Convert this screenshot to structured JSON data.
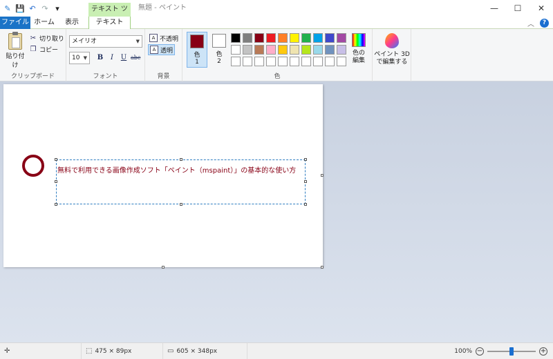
{
  "titlebar": {
    "contextual_tab_group": "テキスト ツール",
    "window_title": "無題 - ペイント",
    "minimize_glyph": "—",
    "maximize_glyph": "☐",
    "close_glyph": "✕",
    "save_glyph": "💾",
    "undo_glyph": "↶",
    "redo_glyph": "↷",
    "customize_glyph": "▾"
  },
  "tabs": {
    "file": "ファイル",
    "home": "ホーム",
    "view": "表示",
    "text": "テキスト"
  },
  "ribbon": {
    "clipboard": {
      "label": "クリップボード",
      "paste": "貼り付け",
      "cut": "切り取り",
      "copy": "コピー"
    },
    "font": {
      "label": "フォント",
      "family": "メイリオ",
      "size": "10",
      "bold": "B",
      "italic": "I",
      "underline": "U",
      "strike": "abc"
    },
    "background": {
      "label": "背景",
      "opaque": "不透明",
      "transparent": "透明",
      "icon_text": "A"
    },
    "colors": {
      "label": "色",
      "color1_label": "色",
      "color1_num": "1",
      "color2_label": "色",
      "color2_num": "2",
      "color1_value": "#880015",
      "color2_value": "#ffffff",
      "edit_line1": "色の",
      "edit_line2": "編集",
      "palette_row1": [
        "#000000",
        "#7f7f7f",
        "#880015",
        "#ed1c24",
        "#ff7f27",
        "#fff200",
        "#22b14c",
        "#00a2e8",
        "#3f48cc",
        "#a349a4"
      ],
      "palette_row2": [
        "#ffffff",
        "#c3c3c3",
        "#b97a57",
        "#ffaec9",
        "#ffc90e",
        "#efe4b0",
        "#b5e61d",
        "#99d9ea",
        "#7092be",
        "#c8bfe7"
      ],
      "palette_row3": [
        "#ffffff",
        "#ffffff",
        "#ffffff",
        "#ffffff",
        "#ffffff",
        "#ffffff",
        "#ffffff",
        "#ffffff",
        "#ffffff",
        "#ffffff"
      ]
    },
    "paint3d": {
      "line1": "ペイント 3D",
      "line2": "で編集する"
    }
  },
  "canvas": {
    "text": "無料で利用できる画像作成ソフト「ペイント（mspaint）」の基本的な使い方",
    "text_color": "#880015"
  },
  "statusbar": {
    "selection_size": "475 × 89px",
    "image_size": "605 × 348px",
    "zoom": "100%",
    "zoom_fraction": 0.5,
    "zoom_out": "−",
    "zoom_in": "+"
  }
}
